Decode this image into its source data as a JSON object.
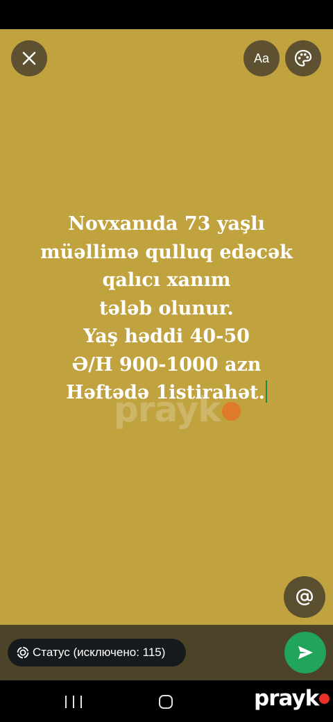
{
  "editor": {
    "font_button_label": "Aa",
    "background_color": "#c0a23f",
    "text_color": "#ffffff"
  },
  "post": {
    "lines": [
      "Novxanıda 73 yaşlı",
      "müəllimə qulluq edəcək",
      "qalıcı xanım",
      "tələb olunur.",
      "Yaş həddi 40-50",
      "Ə/H 900-1000 azn",
      "Həftədə 1istirahət."
    ]
  },
  "status": {
    "label": "Статус (исключено: 115)"
  },
  "watermark": {
    "text": "prayk"
  },
  "icons": {
    "close": "close-icon",
    "palette": "palette-icon",
    "mention": "at-sign-icon",
    "status": "status-ring-icon",
    "send": "send-icon",
    "recent": "recent-apps-icon",
    "home": "home-icon"
  },
  "colors": {
    "send_button": "#21a45b",
    "bottom_panel": "#4c4328",
    "cursor": "#1c8a49"
  }
}
